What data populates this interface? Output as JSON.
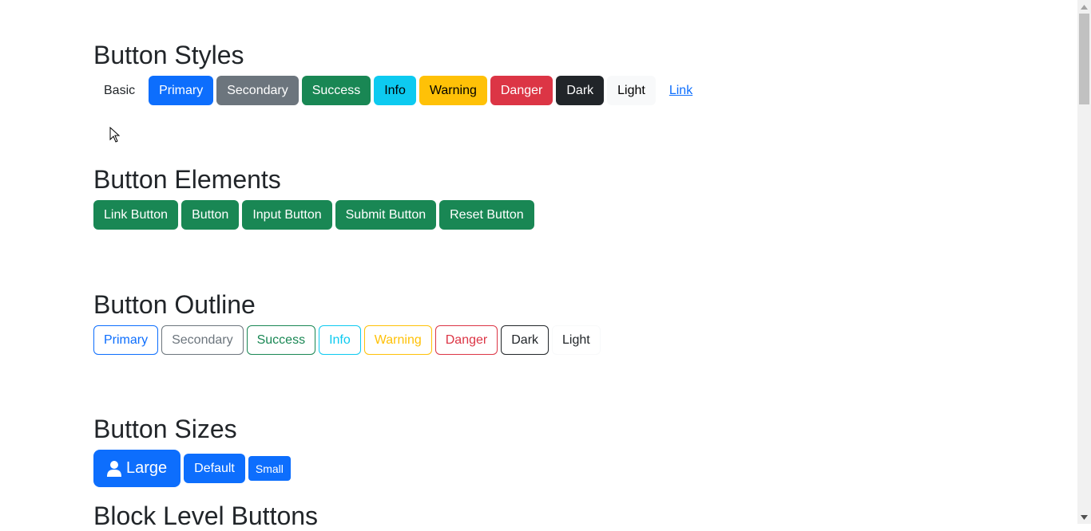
{
  "sections": {
    "styles": {
      "title": "Button Styles",
      "buttons": [
        "Basic",
        "Primary",
        "Secondary",
        "Success",
        "Info",
        "Warning",
        "Danger",
        "Dark",
        "Light",
        "Link"
      ]
    },
    "elements": {
      "title": "Button Elements",
      "buttons": [
        "Link Button",
        "Button",
        "Input Button",
        "Submit Button",
        "Reset Button"
      ]
    },
    "outline": {
      "title": "Button Outline",
      "buttons": [
        "Primary",
        "Secondary",
        "Success",
        "Info",
        "Warning",
        "Danger",
        "Dark",
        "Light"
      ]
    },
    "sizes": {
      "title": "Button Sizes",
      "large": "Large",
      "default": "Default",
      "small": "Small",
      "large_icon": "person-icon"
    },
    "block": {
      "title": "Block Level Buttons"
    }
  },
  "colors": {
    "primary": "#0d6efd",
    "secondary": "#6c757d",
    "success": "#198754",
    "info": "#0dcaf0",
    "warning": "#ffc107",
    "danger": "#dc3545",
    "dark": "#212529",
    "light": "#f8f9fa"
  }
}
